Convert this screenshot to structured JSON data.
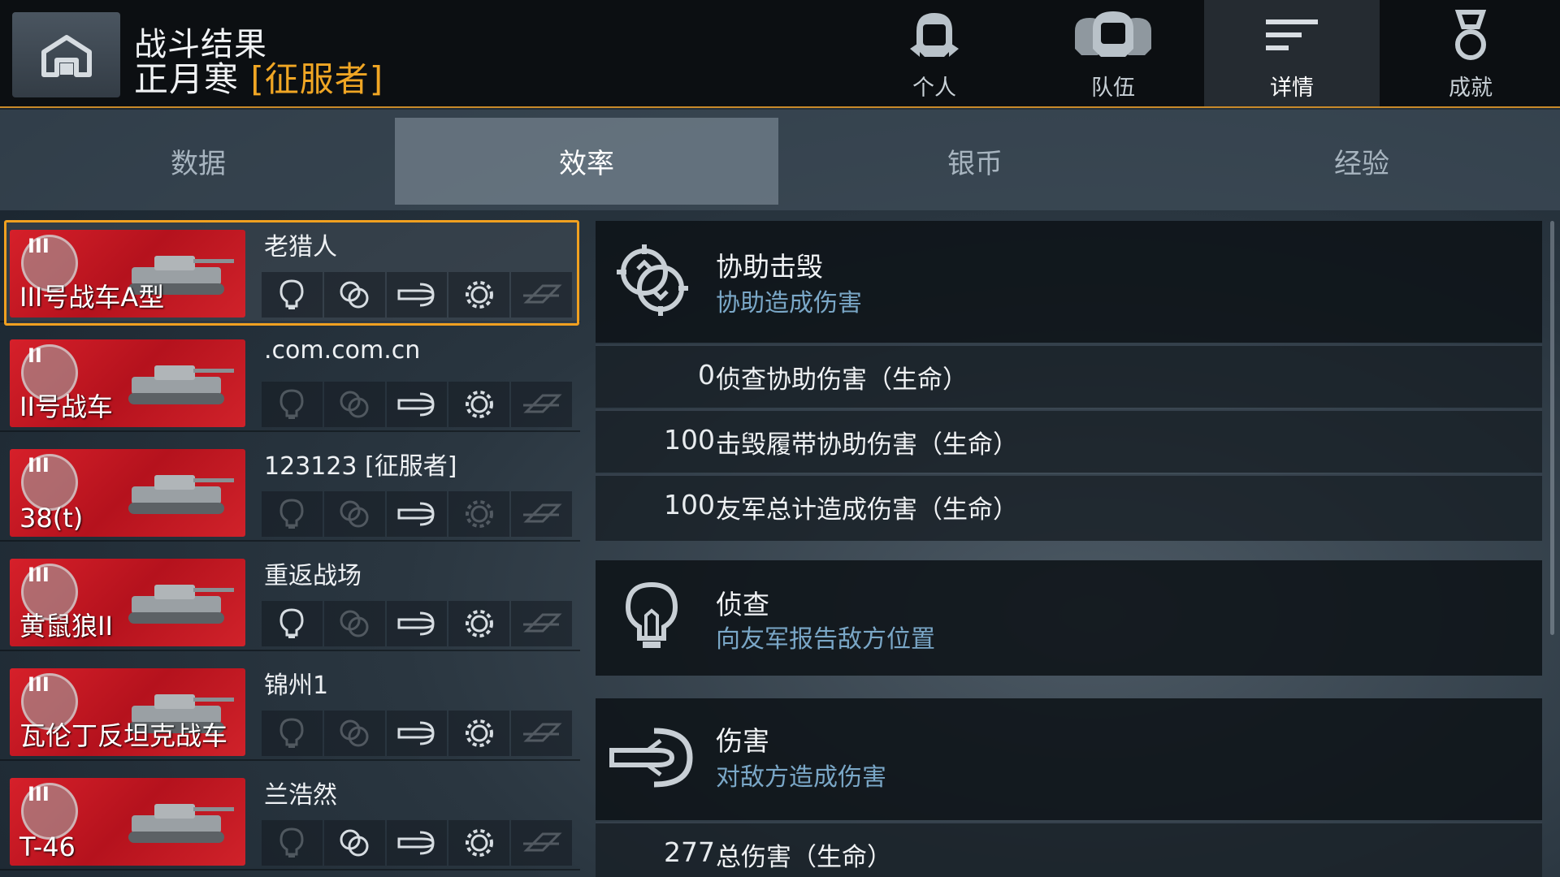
{
  "header": {
    "title": "战斗结果",
    "player": "正月寒",
    "rank": "[征服者]",
    "nav": [
      {
        "label": "个人",
        "icon": "helmet-icon"
      },
      {
        "label": "队伍",
        "icon": "team-icon"
      },
      {
        "label": "详情",
        "icon": "details-icon"
      },
      {
        "label": "成就",
        "icon": "medal-icon"
      }
    ]
  },
  "tabs": [
    "数据",
    "效率",
    "银币",
    "经验"
  ],
  "players": [
    {
      "tank": "III号战车A型",
      "tier": "III",
      "name": "老猎人",
      "badges": [
        true,
        true,
        true,
        true,
        false
      ]
    },
    {
      "tank": "II号战车",
      "tier": "II",
      "name": ".com.com.cn",
      "badges": [
        false,
        false,
        true,
        true,
        false
      ]
    },
    {
      "tank": "38(t)",
      "tier": "III",
      "name": "123123 [征服者]",
      "badges": [
        false,
        false,
        true,
        false,
        false
      ]
    },
    {
      "tank": "黄鼠狼II",
      "tier": "III",
      "name": "重返战场",
      "badges": [
        true,
        false,
        true,
        true,
        false
      ]
    },
    {
      "tank": "瓦伦丁反坦克战车",
      "tier": "III",
      "name": "锦州1",
      "badges": [
        false,
        false,
        true,
        true,
        false
      ]
    },
    {
      "tank": "T-46",
      "tier": "III",
      "name": "兰浩然",
      "badges": [
        false,
        true,
        true,
        true,
        false
      ]
    }
  ],
  "detail": {
    "assist": {
      "title": "协助击毁",
      "subtitle": "协助造成伤害",
      "icon": "assist-icon",
      "rows": [
        {
          "value": "0",
          "label": "侦查协助伤害（生命）"
        },
        {
          "value": "100",
          "label": "击毁履带协助伤害（生命）"
        },
        {
          "value": "100",
          "label": "友军总计造成伤害（生命）"
        }
      ]
    },
    "spot": {
      "title": "侦查",
      "subtitle": "向友军报告敌方位置",
      "icon": "lightbulb-icon"
    },
    "damage": {
      "title": "伤害",
      "subtitle": "对敌方造成伤害",
      "icon": "shell-icon",
      "rows": [
        {
          "value": "277",
          "label": "总伤害（生命）"
        }
      ]
    }
  },
  "colors": {
    "accent": "#f0a624",
    "card_red": "#c8141f",
    "subtitle_blue": "#7aa7c7"
  }
}
